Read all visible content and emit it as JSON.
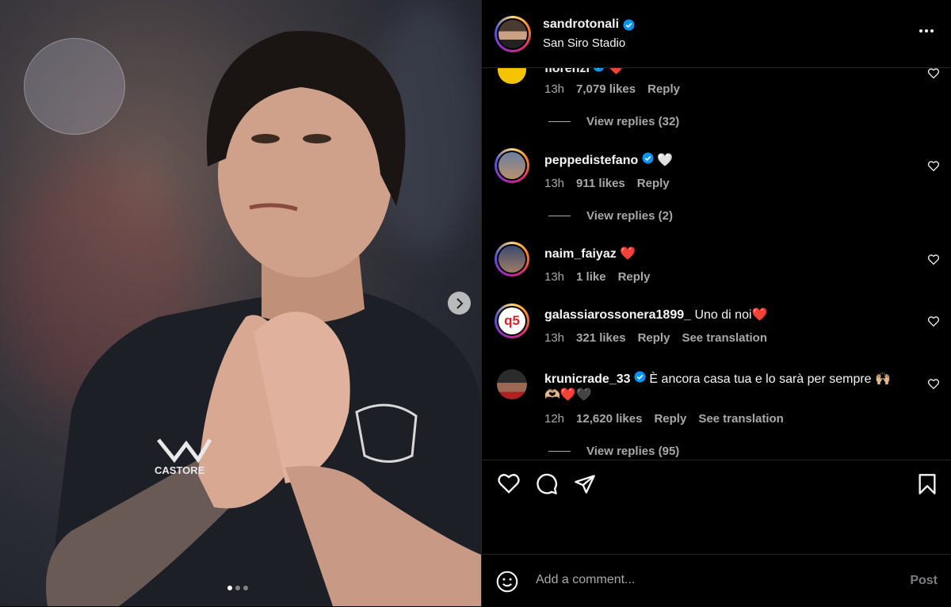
{
  "post": {
    "username": "sandrotonali",
    "location": "San Siro Stadio",
    "carousel": {
      "slide_count": 3,
      "active_index": 0
    }
  },
  "comments": [
    {
      "username": "florenzi",
      "text": "❤️",
      "time": "13h",
      "likes": "7,079 likes",
      "reply": "Reply",
      "view_replies": "View replies (32)",
      "verified": true
    },
    {
      "username": "peppedistefano",
      "text": "🤍",
      "time": "13h",
      "likes": "911 likes",
      "reply": "Reply",
      "view_replies": "View replies (2)",
      "verified": true
    },
    {
      "username": "naim_faiyaz",
      "text": "❤️",
      "time": "13h",
      "likes": "1 like",
      "reply": "Reply"
    },
    {
      "username": "galassiarossonera1899_",
      "text": "Uno di noi❤️",
      "time": "13h",
      "likes": "321 likes",
      "reply": "Reply",
      "translate": "See translation",
      "avatar_text": "q5"
    },
    {
      "username": "krunicrade_33",
      "text": "È ancora casa tua e lo sarà per sempre 🙌🏼 🫶🏼❤️🖤",
      "time": "12h",
      "likes": "12,620 likes",
      "reply": "Reply",
      "translate": "See translation",
      "view_replies": "View replies (95)",
      "verified": true
    }
  ],
  "composer": {
    "placeholder": "Add a comment...",
    "post_label": "Post"
  },
  "icons": [
    "verified-badge-icon",
    "more-options-icon",
    "heart-icon",
    "comment-icon",
    "share-icon",
    "bookmark-icon",
    "emoji-icon",
    "chevron-right-icon"
  ],
  "colors": {
    "background": "#000000",
    "verified": "#0095f6",
    "muted_text": "#a8a8a8",
    "heart_red": "#ff3040"
  }
}
